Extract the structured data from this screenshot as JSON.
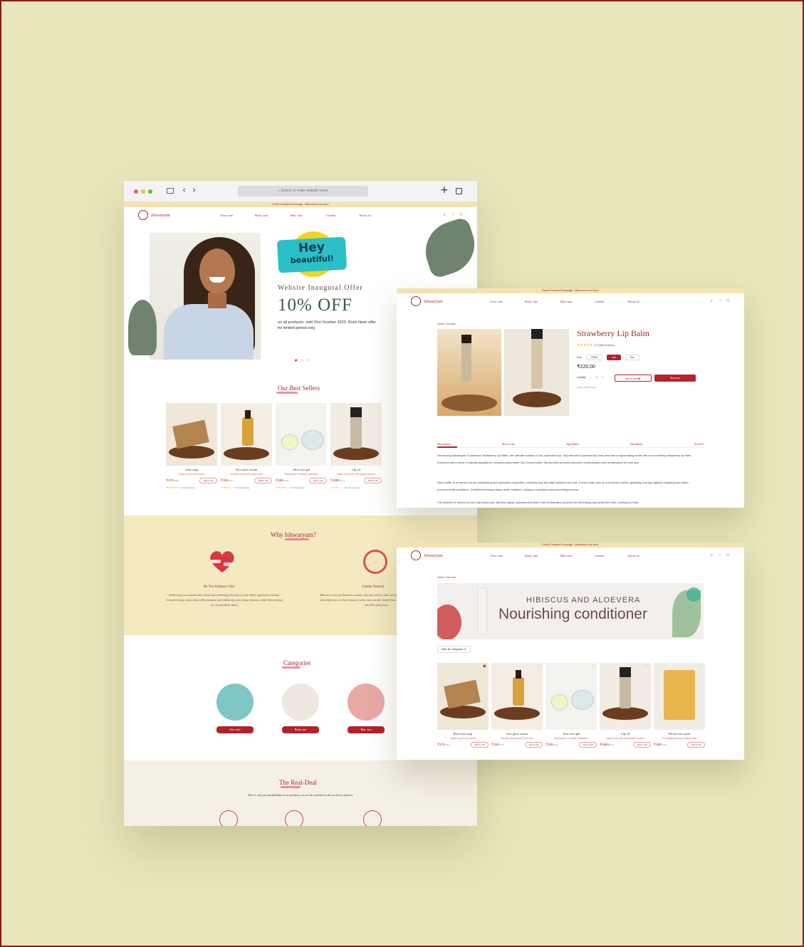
{
  "browser": {
    "url_placeholder": "Search or enter website name"
  },
  "site": {
    "announcement": "Enrich Enhance Encourage - Welcome to our store",
    "logo_text": "Ishwaryam",
    "nav": [
      "Face care",
      "Body care",
      "Hair care",
      "Combo",
      "About Us"
    ],
    "icons": [
      "search-icon",
      "heart-icon",
      "user-icon"
    ]
  },
  "hero": {
    "badge_line1": "Hey",
    "badge_line2": "beautiful!",
    "kicker": "Website Inaugural Offer",
    "offer": "10% OFF",
    "note": "on all products, until 31st October 2023. Rush Now! offer for limited period only."
  },
  "best_sellers": {
    "title": "Our Best Sellers",
    "products": [
      {
        "name": "wine soap",
        "desc": "Helps to get rid of acne",
        "price": "₹170",
        "unit": "/100g",
        "cart": "Add to cart",
        "stars": "★★★★★",
        "reviews": "4.5 (25 reviews)"
      },
      {
        "name": "Face glow serum",
        "desc": "Nourish and protect your skin",
        "price": "₹150",
        "unit": "/30ml",
        "cart": "Add to cart",
        "stars": "★★★★☆",
        "reviews": "3.5 (48 reviews)"
      },
      {
        "name": "Aloe vera gel",
        "desc": "Moisturiser & all day hydration",
        "price": "₹190",
        "unit": "/100g",
        "cart": "Add to cart",
        "stars": "★★★★☆",
        "reviews": "4.5 (42 reviews)"
      },
      {
        "name": "Lip oil",
        "desc": "Have a smooth and supple texture",
        "price": "₹1950",
        "unit": "/10ml",
        "cart": "Add to cart",
        "stars": "★★★☆☆",
        "reviews": "3.6 (20 reviews)"
      }
    ]
  },
  "why": {
    "title": "Why Ishwaryam?",
    "items": [
      {
        "heading": "Be You Embrace You",
        "text": "Embracing your natural skin colour and celebrating diversity is a fair better approach to beauty. Genuine beauty comes from self-acceptance and embracing your unique features, rather than striving for an unrealistic ideal."
      },
      {
        "heading": "Gender Neutral",
        "text": "Skincare is not just limited to women; men also need to take care of their skin. While there might be some differences in their skincare needs, men can also benefit from incorporating a skincare routine into their daily lives."
      }
    ]
  },
  "categories": {
    "title": "Categories",
    "items": [
      "Face care",
      "Body care",
      "Hair care"
    ]
  },
  "real_deal": {
    "title": "The Real-Deal",
    "subtitle": "Here is why you should bank on our products, we are the real deal in the world of cosmetics"
  },
  "product_page": {
    "breadcrumb": "Home / Lip balm",
    "title": "Strawberry Lip Balm",
    "stars": "★★★★★",
    "rating": "4.5",
    "reviews": "(86 reviews)",
    "size_label": "Size",
    "sizes": [
      "200ml",
      "2ml",
      "5ml"
    ],
    "price": "₹220.00",
    "qty_label": "Quantity",
    "qty": "1",
    "add_to_cart": "Add to cart",
    "buy_now": "Buy now",
    "meta": "serial, product, more",
    "tabs": [
      "Description",
      "How to use",
      "Ingredients",
      "Disclaimer",
      "Q and A"
    ],
    "paragraphs": [
      "Introducing Ishwaryam Goodness's Strawberry Lip Balm, the ultimate solution to dry, lackluster lips. Say farewell to parched lips and welcome a rejuvenating smile with our nourishing strawberry lip balm. Enriched with a blend of natural ingredients, including shea butter and Cocoa butter, this lip balm provides intensive moisturization and revitalization for your lips.",
      "Shea butter is renowned for its moisturizing and reparative properties, ensuring your lips stay hydrated and soft. Cocoa butter acts as a protective shield, guarding your lips against chapping and harsh environmental conditions. Unrefined beeswax helps retain moisture, locking in hydration and preventing dryness.",
      "The addition of almond oil not only keeps your lips thoroughly hydrated and aids in the revitalization process by eliminating any dead skin cells, leaving your lips"
    ]
  },
  "listing_page": {
    "breadcrumb": "Home / Hair care",
    "banner_kicker": "HIBISCUS AND ALOEVERA",
    "banner_title": "Nourishing conditioner",
    "filter": "Filter By Categories",
    "products": [
      {
        "name": "Red wine soap",
        "desc": "Helps to get rid of acne",
        "price": "₹170",
        "unit": "/100g",
        "cart": "Add to cart"
      },
      {
        "name": "face glow serum",
        "desc": "Nourish and protect your skin",
        "price": "₹150",
        "unit": "/30ml",
        "cart": "Add to cart"
      },
      {
        "name": "Aloe vera gel",
        "desc": "Moisturiser & all day hydration",
        "price": "₹190",
        "unit": "/100g",
        "cart": "Add to cart"
      },
      {
        "name": "Lip oil",
        "desc": "Have a smooth and supple texture",
        "price": "₹1950",
        "unit": "/10ml",
        "cart": "Add to cart"
      },
      {
        "name": "De-tan face pack",
        "desc": "For brightened and radiant skin",
        "price": "₹190",
        "unit": "/100g",
        "cart": "Add to cart"
      }
    ]
  },
  "colors": {
    "background": "#e8e6bb",
    "brand_red": "#a8262a",
    "accent_yellow": "#f4e9bf",
    "accent_teal": "#2bbfc7"
  }
}
